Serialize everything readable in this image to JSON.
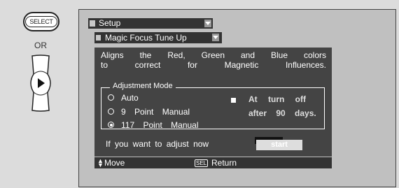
{
  "remote": {
    "select_label": "SELECT",
    "or_label": "OR"
  },
  "menu": {
    "setup_label": "Setup",
    "submenu_label": "Magic Focus Tune Up",
    "description_line1": "Aligns the Red, Green and Blue colors",
    "description_line2": "to correct for Magnetic Influences.",
    "adjustment_mode_title": "Adjustment Mode",
    "options": [
      {
        "label": "Auto",
        "selected": false
      },
      {
        "label": "9 Point Manual",
        "selected": false
      },
      {
        "label": "117 Point Manual",
        "selected": true
      }
    ],
    "auto_note_line1": "At turn off",
    "auto_note_line2": "after 90 days.",
    "adjust_prompt": "If you want to adjust now",
    "start_label": "start",
    "footer_move": "Move",
    "footer_sel_icon": "SEL",
    "footer_return": "Return"
  },
  "colors": {
    "panel_bg": "#444444",
    "bar_bg": "#333333",
    "screen_bg": "#c0c0c0",
    "page_bg": "#dcdcdc"
  },
  "icons": {
    "move": "up-down-arrows-icon",
    "dpad": "dpad-right-icon",
    "dropdown": "chevron-down-icon"
  }
}
